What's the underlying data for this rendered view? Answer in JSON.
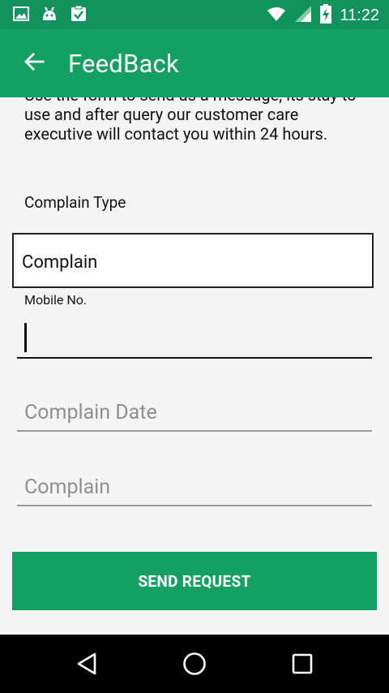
{
  "status_bar": {
    "time": "11:22",
    "icons_left": [
      "image-icon",
      "android-icon",
      "clipboard-check-icon"
    ],
    "icons_right": [
      "wifi-icon",
      "signal-icon",
      "battery-charging-icon"
    ]
  },
  "app_bar": {
    "title": "FeedBack",
    "back_icon": "arrow-left-icon"
  },
  "form": {
    "intro_text": "Use the form to send us a message, its stay to use and after query our customer care executive will contact you within 24 hours.",
    "complain_type_label": "Complain Type",
    "complain_type_value": "Complain",
    "mobile_label": "Mobile No.",
    "mobile_value": "",
    "complain_date_placeholder": "Complain Date",
    "complain_placeholder": "Complain",
    "send_button": "SEND REQUEST"
  },
  "nav_bar": {
    "buttons": [
      "back-triangle-icon",
      "home-circle-icon",
      "recents-square-icon"
    ]
  },
  "colors": {
    "status_bar": "#12925c",
    "app_bar": "#15a063",
    "button": "#15a063",
    "background": "#f5f5f5"
  }
}
